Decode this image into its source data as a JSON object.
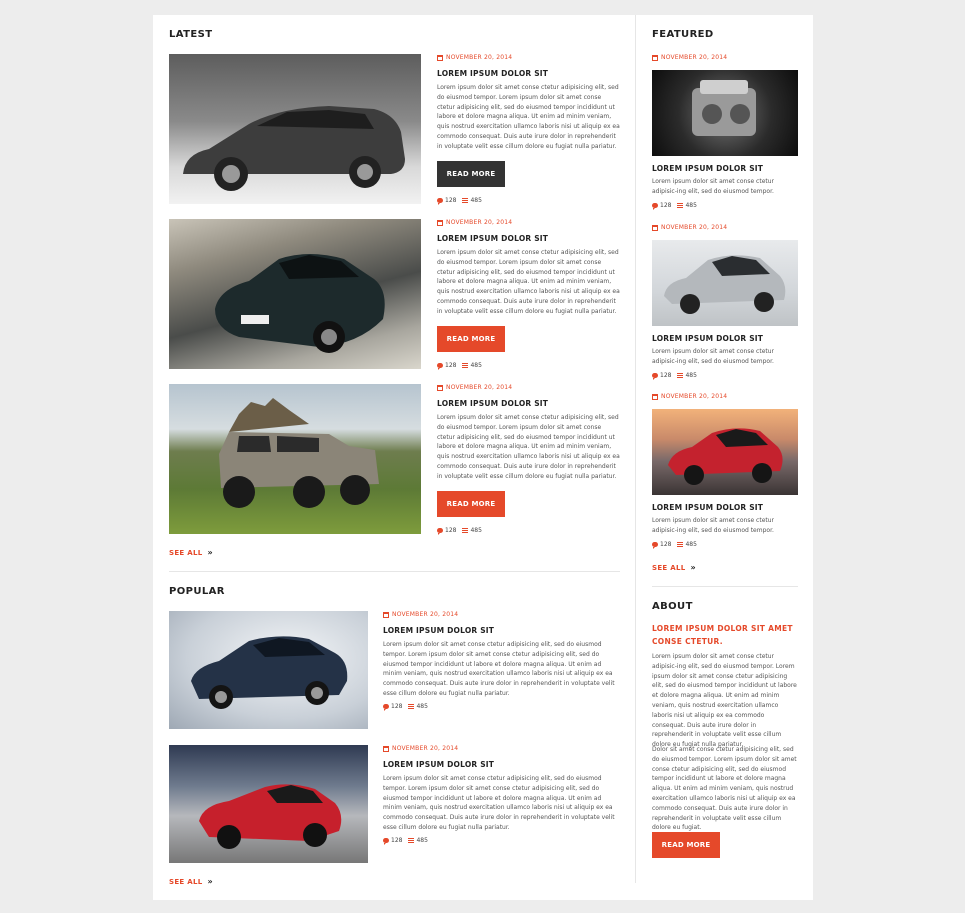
{
  "latest": {
    "title": "LATEST",
    "posts": [
      {
        "date": "NOVEMBER 20, 2014",
        "title": "LOREM IPSUM DOLOR SIT",
        "text": "Lorem ipsum dolor sit amet conse ctetur adipisicing elit, sed do eiusmod tempor. Lorem ipsum dolor sit amet conse ctetur adipisicing elit, sed do eiusmod tempor incididunt ut labore et dolore magna aliqua. Ut enim ad minim veniam, quis nostrud exercitation ullamco laboris nisi ut aliquip ex ea commodo consequat. Duis aute irure dolor in reprehenderit in voluptate velit esse cillum dolore eu fugiat nulla pariatur.",
        "button": "READ MORE",
        "comments": "128",
        "views": "485"
      },
      {
        "date": "NOVEMBER 20, 2014",
        "title": "LOREM IPSUM DOLOR SIT",
        "text": "Lorem ipsum dolor sit amet conse ctetur adipisicing elit, sed do eiusmod tempor. Lorem ipsum dolor sit amet conse ctetur adipisicing elit, sed do eiusmod tempor incididunt ut labore et dolore magna aliqua. Ut enim ad minim veniam, quis nostrud exercitation ullamco laboris nisi ut aliquip ex ea commodo consequat. Duis aute irure dolor in reprehenderit in voluptate velit esse cillum dolore eu fugiat nulla pariatur.",
        "button": "READ MORE",
        "comments": "128",
        "views": "485"
      },
      {
        "date": "NOVEMBER 20, 2014",
        "title": "LOREM IPSUM DOLOR SIT",
        "text": "Lorem ipsum dolor sit amet conse ctetur adipisicing elit, sed do eiusmod tempor. Lorem ipsum dolor sit amet conse ctetur adipisicing elit, sed do eiusmod tempor incididunt ut labore et dolore magna aliqua. Ut enim ad minim veniam, quis nostrud exercitation ullamco laboris nisi ut aliquip ex ea commodo consequat. Duis aute irure dolor in reprehenderit in voluptate velit esse cillum dolore eu fugiat nulla pariatur.",
        "button": "READ MORE",
        "comments": "128",
        "views": "485"
      }
    ],
    "see_all": "SEE ALL"
  },
  "popular": {
    "title": "POPULAR",
    "posts": [
      {
        "date": "NOVEMBER 20, 2014",
        "title": "LOREM IPSUM DOLOR SIT",
        "text": "Lorem ipsum dolor sit amet conse ctetur adipisicing elit, sed do eiusmod tempor. Lorem ipsum dolor sit amet conse ctetur adipisicing elit, sed do eiusmod tempor incididunt ut labore et dolore magna aliqua. Ut enim ad minim veniam, quis nostrud exercitation ullamco laboris nisi ut aliquip ex ea commodo consequat. Duis aute irure dolor in reprehenderit in voluptate velit esse cillum dolore eu fugiat nulla pariatur.",
        "comments": "128",
        "views": "485"
      },
      {
        "date": "NOVEMBER 20, 2014",
        "title": "LOREM IPSUM DOLOR SIT",
        "text": "Lorem ipsum dolor sit amet conse ctetur adipisicing elit, sed do eiusmod tempor. Lorem ipsum dolor sit amet conse ctetur adipisicing elit, sed do eiusmod tempor incididunt ut labore et dolore magna aliqua. Ut enim ad minim veniam, quis nostrud exercitation ullamco laboris nisi ut aliquip ex ea commodo consequat. Duis aute irure dolor in reprehenderit in voluptate velit esse cillum dolore eu fugiat nulla pariatur.",
        "comments": "128",
        "views": "485"
      }
    ],
    "see_all": "SEE ALL"
  },
  "featured": {
    "title": "FEATURED",
    "posts": [
      {
        "date": "NOVEMBER 20, 2014",
        "title": "LOREM IPSUM DOLOR SIT",
        "text": "Lorem ipsum dolor sit amet conse ctetur adipisic-ing elit, sed do eiusmod tempor.",
        "comments": "128",
        "views": "485"
      },
      {
        "date": "NOVEMBER 20, 2014",
        "title": "LOREM IPSUM DOLOR SIT",
        "text": "Lorem ipsum dolor sit amet conse ctetur adipisic-ing elit, sed do eiusmod tempor.",
        "comments": "128",
        "views": "485"
      },
      {
        "date": "NOVEMBER 20, 2014",
        "title": "LOREM IPSUM DOLOR SIT",
        "text": "Lorem ipsum dolor sit amet conse ctetur adipisic-ing elit, sed do eiusmod tempor.",
        "comments": "128",
        "views": "485"
      }
    ],
    "see_all": "SEE ALL"
  },
  "about": {
    "title": "ABOUT",
    "heading": "LOREM IPSUM DOLOR SIT AMET CONSE CTETUR.",
    "para1": "Lorem ipsum dolor sit amet conse ctetur adipisic-ing elit, sed do eiusmod tempor. Lorem ipsum dolor sit amet conse ctetur adipisicing elit, sed do eiusmod tempor incididunt ut labore et dolore magna aliqua. Ut enim ad minim veniam, quis nostrud exercitation ullamco laboris nisi ut aliquip ex ea commodo consequat. Duis aute irure dolor in reprehenderit in voluptate velit esse cillum dolore eu fugiat nulla pariatur.",
    "para2": "Dolor sit amet conse ctetur adipisicing elit, sed do eiusmod tempor. Lorem ipsum dolor sit amet conse ctetur adipisicing elit, sed do eiusmod tempor incididunt ut labore et dolore magna aliqua. Ut enim ad minim veniam, quis nostrud exercitation ullamco laboris nisi ut aliquip ex ea commodo consequat. Duis aute irure dolor in reprehenderit in voluptate velit esse cillum dolore eu fugiat.",
    "button": "READ MORE"
  },
  "colors": {
    "accent": "#e5492a",
    "dark_button": "#333333"
  }
}
